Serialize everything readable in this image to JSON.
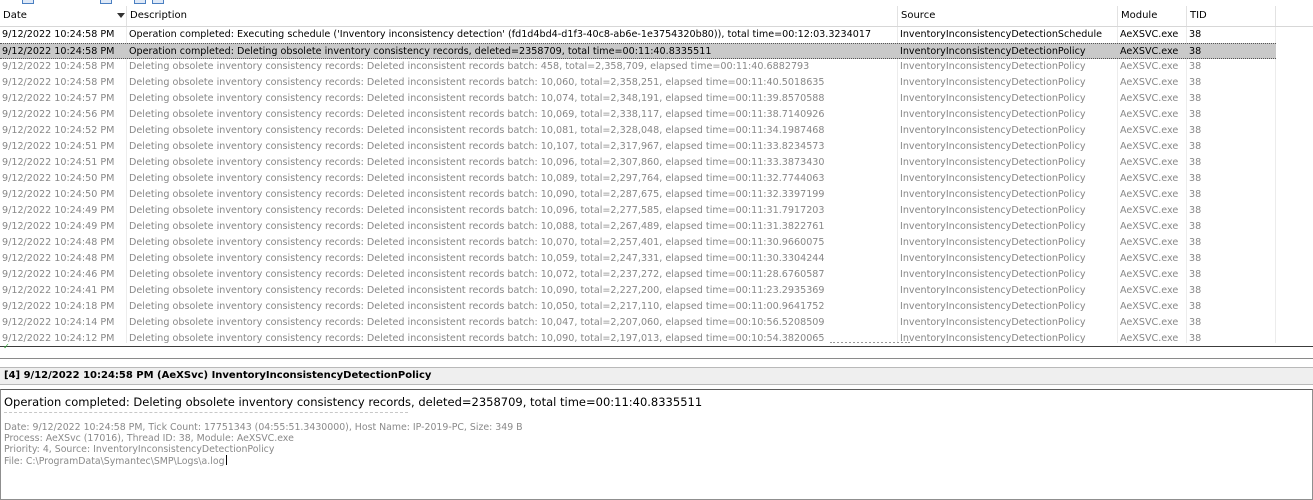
{
  "columns": {
    "date": "Date",
    "description": "Description",
    "source": "Source",
    "module": "Module",
    "tid": "TID"
  },
  "rows": [
    {
      "date": "9/12/2022 10:24:58 PM",
      "description": "Operation completed: Executing schedule ('Inventory inconsistency detection' (fd1d4bd4-d1f3-40c8-ab6e-1e3754320b80)), total time=00:12:03.3234017",
      "source": "InventoryInconsistencyDetectionSchedule",
      "module": "AeXSVC.exe",
      "tid": "38",
      "style": "bold"
    },
    {
      "date": "9/12/2022 10:24:58 PM",
      "description": "Operation completed: Deleting obsolete inventory consistency records, deleted=2358709, total time=00:11:40.8335511",
      "source": "InventoryInconsistencyDetectionPolicy",
      "module": "AeXSVC.exe",
      "tid": "38",
      "style": "selected"
    },
    {
      "date": "9/12/2022 10:24:58 PM",
      "description": "Deleting obsolete inventory consistency records: Deleted inconsistent records batch: 458, total=2,358,709, elapsed time=00:11:40.6882793",
      "source": "InventoryInconsistencyDetectionPolicy",
      "module": "AeXSVC.exe",
      "tid": "38",
      "style": "normal"
    },
    {
      "date": "9/12/2022 10:24:58 PM",
      "description": "Deleting obsolete inventory consistency records: Deleted inconsistent records batch: 10,060, total=2,358,251, elapsed time=00:11:40.5018635",
      "source": "InventoryInconsistencyDetectionPolicy",
      "module": "AeXSVC.exe",
      "tid": "38",
      "style": "normal"
    },
    {
      "date": "9/12/2022 10:24:57 PM",
      "description": "Deleting obsolete inventory consistency records: Deleted inconsistent records batch: 10,074, total=2,348,191, elapsed time=00:11:39.8570588",
      "source": "InventoryInconsistencyDetectionPolicy",
      "module": "AeXSVC.exe",
      "tid": "38",
      "style": "normal"
    },
    {
      "date": "9/12/2022 10:24:56 PM",
      "description": "Deleting obsolete inventory consistency records: Deleted inconsistent records batch: 10,069, total=2,338,117, elapsed time=00:11:38.7140926",
      "source": "InventoryInconsistencyDetectionPolicy",
      "module": "AeXSVC.exe",
      "tid": "38",
      "style": "normal"
    },
    {
      "date": "9/12/2022 10:24:52 PM",
      "description": "Deleting obsolete inventory consistency records: Deleted inconsistent records batch: 10,081, total=2,328,048, elapsed time=00:11:34.1987468",
      "source": "InventoryInconsistencyDetectionPolicy",
      "module": "AeXSVC.exe",
      "tid": "38",
      "style": "normal"
    },
    {
      "date": "9/12/2022 10:24:51 PM",
      "description": "Deleting obsolete inventory consistency records: Deleted inconsistent records batch: 10,107, total=2,317,967, elapsed time=00:11:33.8234573",
      "source": "InventoryInconsistencyDetectionPolicy",
      "module": "AeXSVC.exe",
      "tid": "38",
      "style": "normal"
    },
    {
      "date": "9/12/2022 10:24:51 PM",
      "description": "Deleting obsolete inventory consistency records: Deleted inconsistent records batch: 10,096, total=2,307,860, elapsed time=00:11:33.3873430",
      "source": "InventoryInconsistencyDetectionPolicy",
      "module": "AeXSVC.exe",
      "tid": "38",
      "style": "normal"
    },
    {
      "date": "9/12/2022 10:24:50 PM",
      "description": "Deleting obsolete inventory consistency records: Deleted inconsistent records batch: 10,089, total=2,297,764, elapsed time=00:11:32.7744063",
      "source": "InventoryInconsistencyDetectionPolicy",
      "module": "AeXSVC.exe",
      "tid": "38",
      "style": "normal"
    },
    {
      "date": "9/12/2022 10:24:50 PM",
      "description": "Deleting obsolete inventory consistency records: Deleted inconsistent records batch: 10,090, total=2,287,675, elapsed time=00:11:32.3397199",
      "source": "InventoryInconsistencyDetectionPolicy",
      "module": "AeXSVC.exe",
      "tid": "38",
      "style": "normal"
    },
    {
      "date": "9/12/2022 10:24:49 PM",
      "description": "Deleting obsolete inventory consistency records: Deleted inconsistent records batch: 10,096, total=2,277,585, elapsed time=00:11:31.7917203",
      "source": "InventoryInconsistencyDetectionPolicy",
      "module": "AeXSVC.exe",
      "tid": "38",
      "style": "normal"
    },
    {
      "date": "9/12/2022 10:24:49 PM",
      "description": "Deleting obsolete inventory consistency records: Deleted inconsistent records batch: 10,088, total=2,267,489, elapsed time=00:11:31.3822761",
      "source": "InventoryInconsistencyDetectionPolicy",
      "module": "AeXSVC.exe",
      "tid": "38",
      "style": "normal"
    },
    {
      "date": "9/12/2022 10:24:48 PM",
      "description": "Deleting obsolete inventory consistency records: Deleted inconsistent records batch: 10,070, total=2,257,401, elapsed time=00:11:30.9660075",
      "source": "InventoryInconsistencyDetectionPolicy",
      "module": "AeXSVC.exe",
      "tid": "38",
      "style": "normal"
    },
    {
      "date": "9/12/2022 10:24:48 PM",
      "description": "Deleting obsolete inventory consistency records: Deleted inconsistent records batch: 10,059, total=2,247,331, elapsed time=00:11:30.3304244",
      "source": "InventoryInconsistencyDetectionPolicy",
      "module": "AeXSVC.exe",
      "tid": "38",
      "style": "normal"
    },
    {
      "date": "9/12/2022 10:24:46 PM",
      "description": "Deleting obsolete inventory consistency records: Deleted inconsistent records batch: 10,072, total=2,237,272, elapsed time=00:11:28.6760587",
      "source": "InventoryInconsistencyDetectionPolicy",
      "module": "AeXSVC.exe",
      "tid": "38",
      "style": "normal"
    },
    {
      "date": "9/12/2022 10:24:41 PM",
      "description": "Deleting obsolete inventory consistency records: Deleted inconsistent records batch: 10,090, total=2,227,200, elapsed time=00:11:23.2935369",
      "source": "InventoryInconsistencyDetectionPolicy",
      "module": "AeXSVC.exe",
      "tid": "38",
      "style": "normal"
    },
    {
      "date": "9/12/2022 10:24:18 PM",
      "description": "Deleting obsolete inventory consistency records: Deleted inconsistent records batch: 10,050, total=2,217,110, elapsed time=00:11:00.9641752",
      "source": "InventoryInconsistencyDetectionPolicy",
      "module": "AeXSVC.exe",
      "tid": "38",
      "style": "normal"
    },
    {
      "date": "9/12/2022 10:24:14 PM",
      "description": "Deleting obsolete inventory consistency records: Deleted inconsistent records batch: 10,047, total=2,207,060, elapsed time=00:10:56.5208509",
      "source": "InventoryInconsistencyDetectionPolicy",
      "module": "AeXSVC.exe",
      "tid": "38",
      "style": "normal"
    },
    {
      "date": "9/12/2022 10:24:12 PM",
      "description": "Deleting obsolete inventory consistency records: Deleted inconsistent records batch: 10,090, total=2,197,013, elapsed time=00:10:54.3820065",
      "source": "InventoryInconsistencyDetectionPolicy",
      "module": "AeXSVC.exe",
      "tid": "38",
      "style": "normal"
    }
  ],
  "detail": {
    "header": "[4] 9/12/2022 10:24:58 PM (AeXSvc) InventoryInconsistencyDetectionPolicy",
    "message": "Operation completed: Deleting obsolete inventory consistency records, deleted=2358709, total time=00:11:40.8335511",
    "line_date": "Date: 9/12/2022 10:24:58 PM, Tick Count: 17751343 (04:55:51.3430000), Host Name: IP-2019-PC, Size: 349 B",
    "line_process": "Process: AeXSvc (17016), Thread ID: 38, Module: AeXSVC.exe",
    "line_priority": "Priority: 4, Source: InventoryInconsistencyDetectionPolicy",
    "line_file": "File: C:\\ProgramData\\Symantec\\SMP\\Logs\\a.log"
  },
  "colors": {
    "selected_row": "#c9c9c9",
    "dim_text": "#888888",
    "header_bg": "#efefef"
  }
}
